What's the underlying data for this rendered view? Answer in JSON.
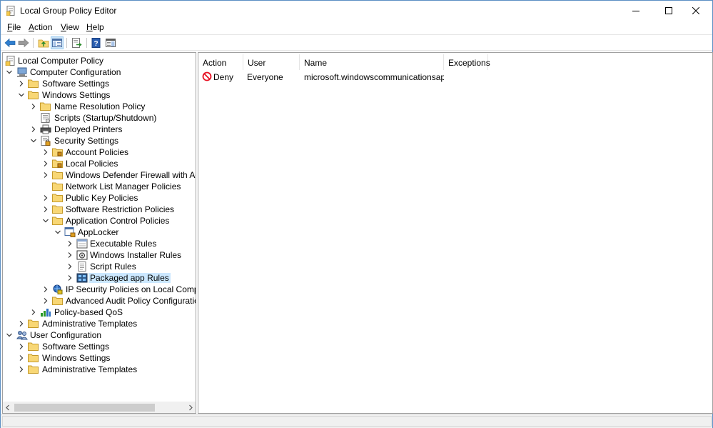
{
  "window": {
    "title": "Local Group Policy Editor"
  },
  "menu": {
    "items": [
      {
        "label": "File",
        "key": "F",
        "rest": "ile"
      },
      {
        "label": "Action",
        "key": "A",
        "rest": "ction"
      },
      {
        "label": "View",
        "key": "V",
        "rest": "iew"
      },
      {
        "label": "Help",
        "key": "H",
        "rest": "elp"
      }
    ]
  },
  "toolbar": {
    "buttons": [
      "back-icon",
      "forward-icon",
      "up-folder-icon",
      "show-hide-tree-icon",
      "export-list-icon",
      "help-icon",
      "properties-pane-icon"
    ]
  },
  "tree": {
    "root": "Local Computer Policy",
    "computer_configuration": "Computer Configuration",
    "software_settings": "Software Settings",
    "windows_settings": "Windows Settings",
    "name_resolution_policy": "Name Resolution Policy",
    "scripts": "Scripts (Startup/Shutdown)",
    "deployed_printers": "Deployed Printers",
    "security_settings": "Security Settings",
    "account_policies": "Account Policies",
    "local_policies": "Local Policies",
    "windows_defender_firewall": "Windows Defender Firewall with Advan",
    "network_list_manager": "Network List Manager Policies",
    "public_key_policies": "Public Key Policies",
    "software_restriction_policies": "Software Restriction Policies",
    "application_control_policies": "Application Control Policies",
    "applocker": "AppLocker",
    "executable_rules": "Executable Rules",
    "windows_installer_rules": "Windows Installer Rules",
    "script_rules": "Script Rules",
    "packaged_app_rules": "Packaged app Rules",
    "ip_security_policies": "IP Security Policies on Local Computer",
    "advanced_audit_policy": "Advanced Audit Policy Configuration",
    "policy_based_qos": "Policy-based QoS",
    "admin_templates_computer": "Administrative Templates",
    "user_configuration": "User Configuration",
    "user_software_settings": "Software Settings",
    "user_windows_settings": "Windows Settings",
    "admin_templates_user": "Administrative Templates"
  },
  "list": {
    "columns": [
      "Action",
      "User",
      "Name",
      "Exceptions"
    ],
    "rows": [
      {
        "action": "Deny",
        "user": "Everyone",
        "name": "microsoft.windowscommunicationsap...",
        "exceptions": ""
      }
    ]
  },
  "colors": {
    "selection": "#cce8ff",
    "folder": "#f8d775",
    "deny_red": "#e81123"
  }
}
